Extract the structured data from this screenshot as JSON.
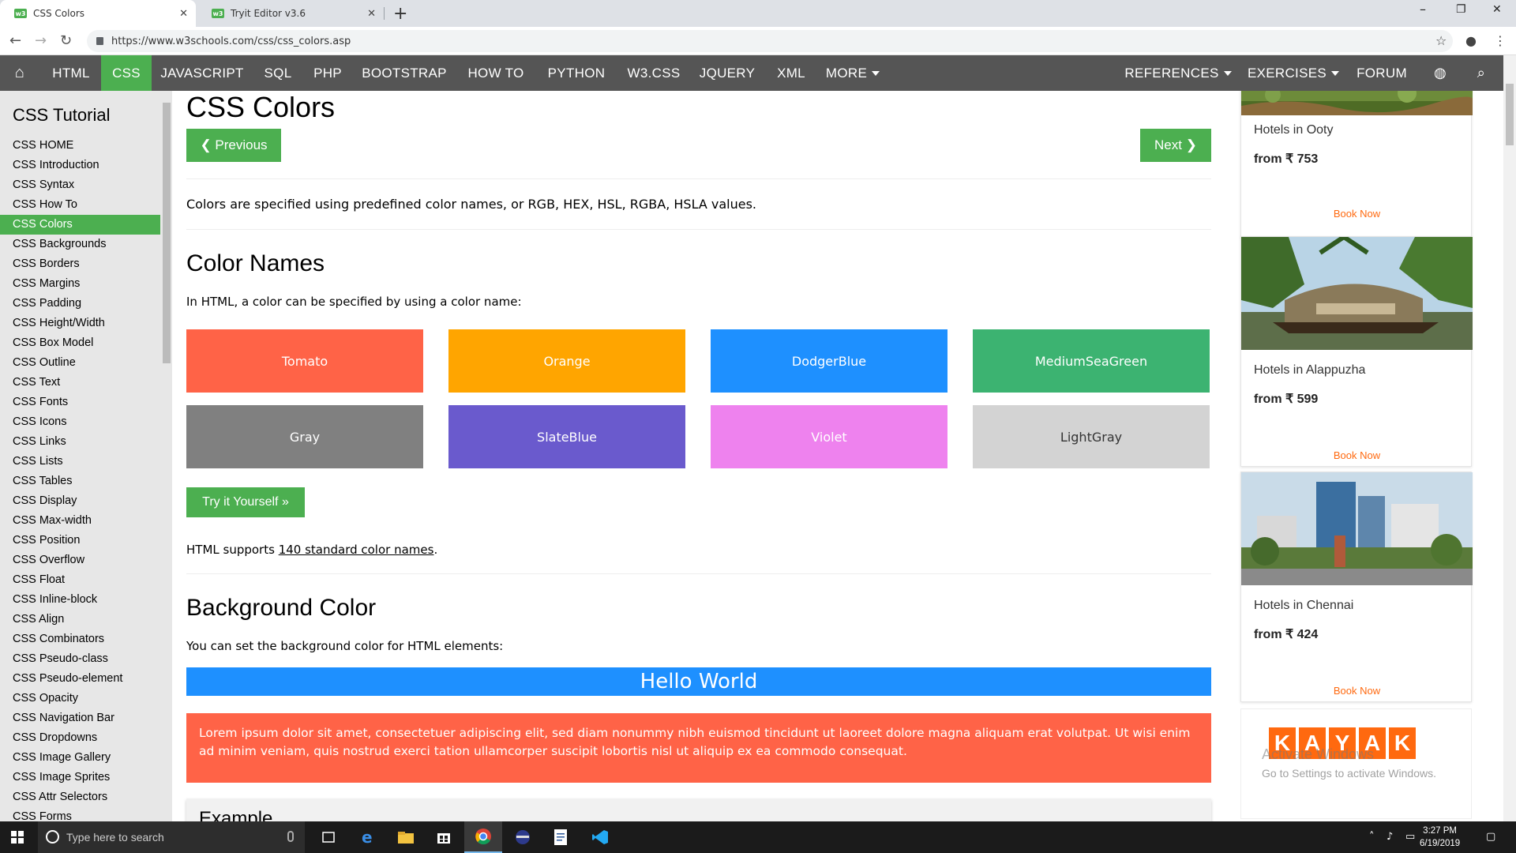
{
  "browser": {
    "tabs": [
      {
        "title": "CSS Colors",
        "active": true
      },
      {
        "title": "Tryit Editor v3.6",
        "active": false
      }
    ],
    "url": "https://www.w3schools.com/css/css_colors.asp",
    "favicon_text": "w3"
  },
  "topnav": {
    "items": [
      "HTML",
      "CSS",
      "JAVASCRIPT",
      "SQL",
      "PHP",
      "BOOTSTRAP",
      "HOW TO",
      "PYTHON",
      "W3.CSS",
      "JQUERY",
      "XML",
      "MORE"
    ],
    "active": "CSS",
    "right_items": [
      "REFERENCES",
      "EXERCISES",
      "FORUM"
    ]
  },
  "sidebar": {
    "heading": "CSS Tutorial",
    "items": [
      "CSS HOME",
      "CSS Introduction",
      "CSS Syntax",
      "CSS How To",
      "CSS Colors",
      "CSS Backgrounds",
      "CSS Borders",
      "CSS Margins",
      "CSS Padding",
      "CSS Height/Width",
      "CSS Box Model",
      "CSS Outline",
      "CSS Text",
      "CSS Fonts",
      "CSS Icons",
      "CSS Links",
      "CSS Lists",
      "CSS Tables",
      "CSS Display",
      "CSS Max-width",
      "CSS Position",
      "CSS Overflow",
      "CSS Float",
      "CSS Inline-block",
      "CSS Align",
      "CSS Combinators",
      "CSS Pseudo-class",
      "CSS Pseudo-element",
      "CSS Opacity",
      "CSS Navigation Bar",
      "CSS Dropdowns",
      "CSS Image Gallery",
      "CSS Image Sprites",
      "CSS Attr Selectors",
      "CSS Forms"
    ],
    "active": "CSS Colors"
  },
  "main": {
    "title": "CSS Colors",
    "prev_label": "❮ Previous",
    "next_label": "Next ❯",
    "intro": "Colors are specified using predefined color names, or RGB, HEX, HSL, RGBA, HSLA values.",
    "color_names_heading": "Color Names",
    "color_names_text": "In HTML, a color can be specified by using a color name:",
    "colors": [
      {
        "name": "Tomato",
        "bg": "#ff6347",
        "fg": "#ffffff"
      },
      {
        "name": "Orange",
        "bg": "#ffa500",
        "fg": "#ffffff"
      },
      {
        "name": "DodgerBlue",
        "bg": "#1e90ff",
        "fg": "#ffffff"
      },
      {
        "name": "MediumSeaGreen",
        "bg": "#3cb371",
        "fg": "#ffffff"
      },
      {
        "name": "Gray",
        "bg": "#808080",
        "fg": "#ffffff"
      },
      {
        "name": "SlateBlue",
        "bg": "#6a5acd",
        "fg": "#ffffff"
      },
      {
        "name": "Violet",
        "bg": "#ee82ee",
        "fg": "#ffffff"
      },
      {
        "name": "LightGray",
        "bg": "#d3d3d3",
        "fg": "#333333"
      }
    ],
    "try_label": "Try it Yourself »",
    "supports_prefix": "HTML supports ",
    "supports_link": "140 standard color names",
    "supports_suffix": ".",
    "bg_heading": "Background Color",
    "bg_text": "You can set the background color for HTML elements:",
    "hello_world": "Hello World",
    "lorem": "Lorem ipsum dolor sit amet, consectetuer adipiscing elit, sed diam nonummy nibh euismod tincidunt ut laoreet dolore magna aliquam erat volutpat. Ut wisi enim ad minim veniam, quis nostrud exerci tation ullamcorper suscipit lobortis nisl ut aliquip ex ea commodo consequat.",
    "example_heading": "Example"
  },
  "ads": {
    "hotels": [
      {
        "name": "Hotels in Ooty",
        "price": "from ₹ 753",
        "cta": "Book Now"
      },
      {
        "name": "Hotels in Alappuzha",
        "price": "from ₹ 599",
        "cta": "Book Now"
      },
      {
        "name": "Hotels in Chennai",
        "price": "from ₹ 424",
        "cta": "Book Now"
      }
    ],
    "kayak_letters": [
      "K",
      "A",
      "Y",
      "A",
      "K"
    ],
    "watermark_title": "Activate Windows",
    "watermark_sub": "Go to Settings to activate Windows."
  },
  "taskbar": {
    "search_placeholder": "Type here to search",
    "time": "3:27 PM",
    "date": "6/19/2019"
  },
  "colors": {
    "w3_green": "#4caf50",
    "topnav_bg": "#555555",
    "sidebar_bg": "#e7e7e7",
    "kayak_orange": "#ff690f"
  }
}
